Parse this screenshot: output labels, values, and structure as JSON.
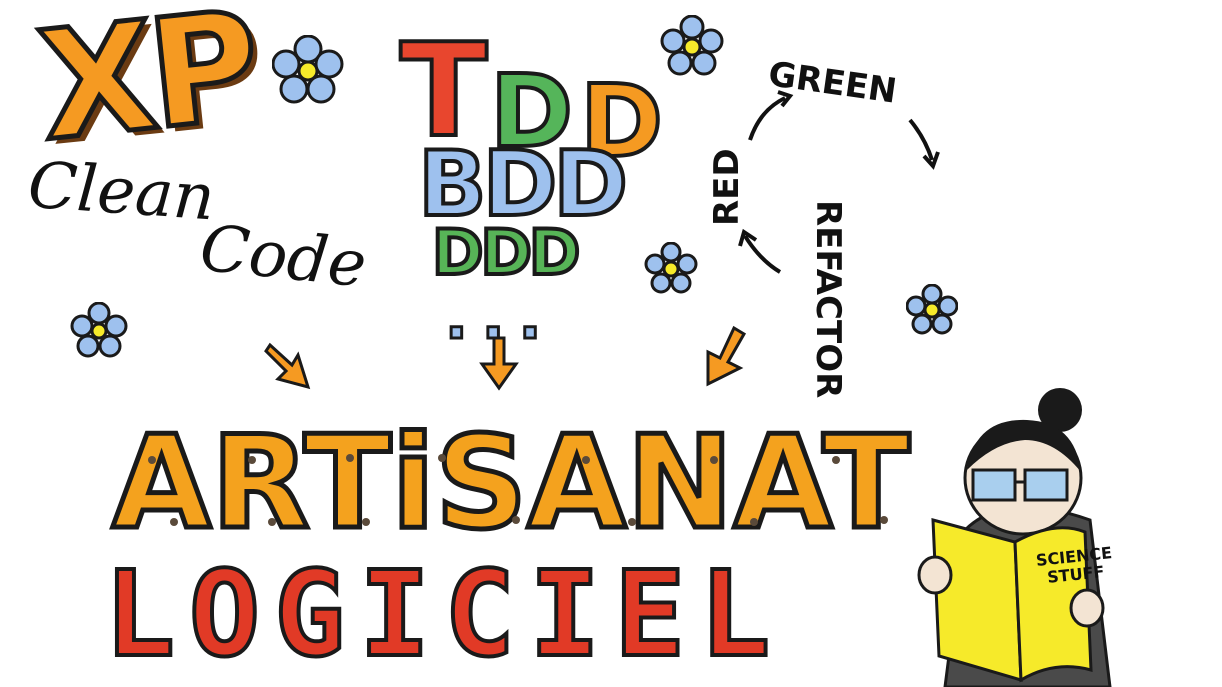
{
  "xp": {
    "text": "XP"
  },
  "clean_code": {
    "line1": "Clean",
    "line2": "Code"
  },
  "methods": {
    "tdd_t": "T",
    "tdd_d1": "D",
    "tdd_d2": "D",
    "bdd": "BDD",
    "ddd": "DDD",
    "ellipsis": "..."
  },
  "cycle": {
    "green": "GREEN",
    "refactor": "REFACTOR",
    "red": "RED"
  },
  "title": {
    "word1": "ARTiSANAT",
    "word2": "LOGICIEL"
  },
  "book": {
    "line1": "SCIENCE",
    "line2": "STUFF"
  },
  "colors": {
    "orange": "#f59a22",
    "red": "#e13a26",
    "green": "#55b55a",
    "blue": "#9ec1ee",
    "yellow": "#f6ea2a"
  },
  "icons": [
    "flower-icon",
    "arrow-down-icon",
    "cycle-arrow-icon",
    "reading-person-illustration"
  ]
}
